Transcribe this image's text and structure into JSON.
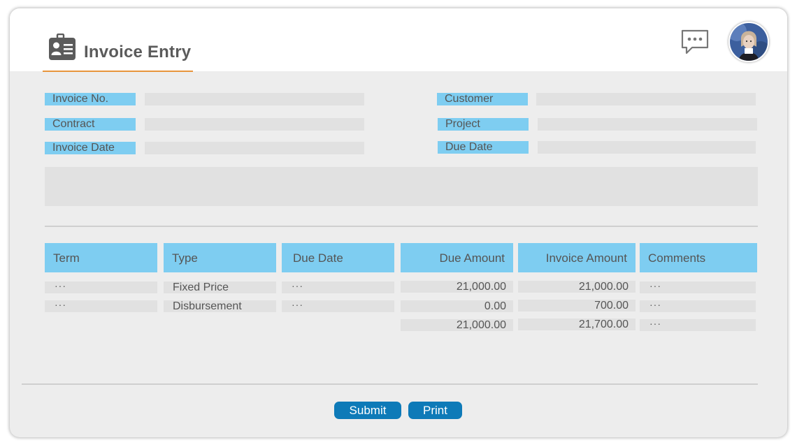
{
  "header": {
    "title": "Invoice Entry",
    "title_icon": "id-card-icon",
    "chat_icon": "chat-bubble-icon",
    "avatar": "user-avatar"
  },
  "form": {
    "left": [
      {
        "label": "Invoice No.",
        "value": ""
      },
      {
        "label": "Contract",
        "value": ""
      },
      {
        "label": "Invoice Date",
        "value": ""
      }
    ],
    "right": [
      {
        "label": "Customer",
        "value": ""
      },
      {
        "label": "Project",
        "value": ""
      },
      {
        "label": "Due Date",
        "value": ""
      }
    ],
    "notes": ""
  },
  "table": {
    "headers": [
      "Term",
      "Type",
      "Due Date",
      "Due Amount",
      "Invoice Amount",
      "Comments"
    ],
    "rows": [
      {
        "term": "···",
        "type": "Fixed Price",
        "due_date": "···",
        "due_amount": "21,000.00",
        "invoice_amount": "21,000.00",
        "comments": "···"
      },
      {
        "term": "···",
        "type": "Disbursement",
        "due_date": "···",
        "due_amount": "0.00",
        "invoice_amount": "700.00",
        "comments": "···"
      }
    ],
    "totals": {
      "due_amount": "21,000.00",
      "invoice_amount": "21,700.00",
      "comments": "···"
    }
  },
  "buttons": {
    "submit": "Submit",
    "print": "Print"
  },
  "colors": {
    "accent": "#7ecdf1",
    "button": "#0e7ab8",
    "underline": "#e8953c",
    "field": "#e1e1e1",
    "panel": "#ededed"
  }
}
